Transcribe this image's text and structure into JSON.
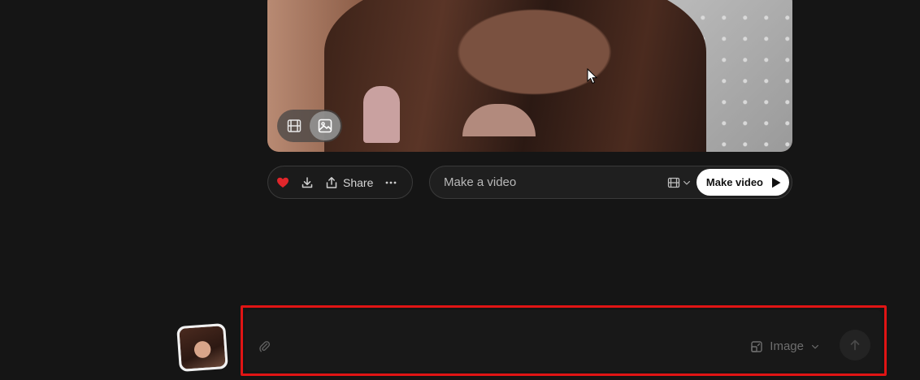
{
  "media": {
    "toggle": {
      "video_icon": "film-icon",
      "image_icon": "image-icon",
      "active": "image"
    }
  },
  "actions": {
    "like_icon": "heart-icon",
    "like_color": "#e0262b",
    "download_icon": "download-icon",
    "share_label": "Share",
    "more_icon": "more-horizontal-icon"
  },
  "video_prompt": {
    "placeholder": "Make a video",
    "mode_icon": "film-icon",
    "button_label": "Make video"
  },
  "composer": {
    "placeholder": "",
    "attach_icon": "paperclip-icon",
    "mode_label": "Image",
    "send_icon": "arrow-up-icon",
    "highlight_color": "#e01414"
  }
}
